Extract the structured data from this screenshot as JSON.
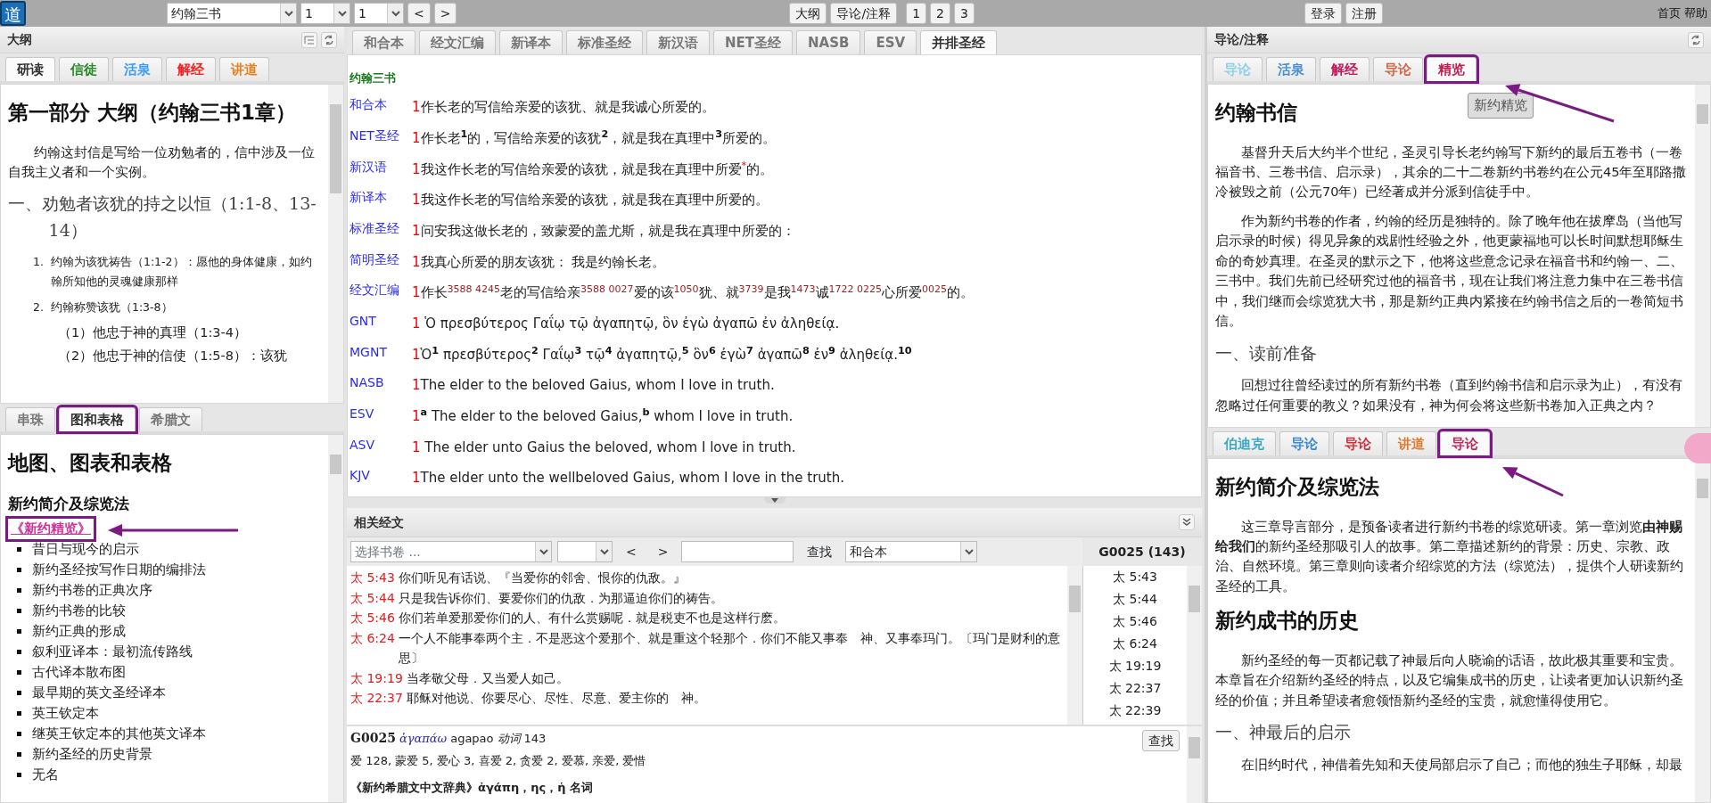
{
  "top_bar": {
    "logo": "道",
    "book_select": "约翰三书",
    "chapter_select": "1",
    "verse_select": "1",
    "prev": "<",
    "next": ">",
    "center_buttons": [
      "大纲",
      "导论/注释"
    ],
    "page_buttons": [
      "1",
      "2",
      "3"
    ],
    "account_buttons": [
      "登录",
      "注册"
    ],
    "links": [
      "首页",
      "帮助"
    ]
  },
  "outline_panel": {
    "title": "大纲",
    "tabs": [
      {
        "label": "研读",
        "color": "#333333",
        "selected": true
      },
      {
        "label": "信徒",
        "color": "#2a8a2a",
        "selected": false
      },
      {
        "label": "活泉",
        "color": "#3b9cff",
        "selected": false
      },
      {
        "label": "解经",
        "color": "#ff1a1a",
        "selected": false
      },
      {
        "label": "讲道",
        "color": "#e8801f",
        "selected": false
      }
    ],
    "content": [
      {
        "kind": "h1",
        "text": "第一部分 大纲（约翰三书1章）"
      },
      {
        "kind": "para",
        "text": "约翰这封信是写给一位劝勉者的，信中涉及一位自我主义者和一个实例。"
      },
      {
        "kind": "serif",
        "text": "一、劝勉者该犹的持之以恒（1:1-8、13-14）"
      },
      {
        "kind": "numbered",
        "number": "1.",
        "text": "约翰为该犹祷告（1:1-2）：愿他的身体健康，如约翰所知他的灵魂健康那样"
      },
      {
        "kind": "numbered",
        "number": "2.",
        "text": "约翰称赞该犹（1:3-8）"
      },
      {
        "kind": "sub",
        "text": "（1）他忠于神的真理（1:3-4）"
      },
      {
        "kind": "sub",
        "text": "（2）他忠于神的信使（1:5-8）：该犹"
      }
    ]
  },
  "charts_panel": {
    "tabs": [
      {
        "label": "串珠",
        "selected": false,
        "highlighted": false
      },
      {
        "label": "图和表格",
        "selected": true,
        "highlighted": true
      },
      {
        "label": "希腊文",
        "selected": false,
        "highlighted": false
      }
    ],
    "content": [
      {
        "kind": "h1",
        "text": "地图、图表和表格"
      },
      {
        "kind": "h3",
        "text": "新约简介及综览法"
      },
      {
        "kind": "link",
        "text": "《新约精览》",
        "highlighted": true,
        "arrow": true
      },
      {
        "kind": "bullet",
        "text": "昔日与现今的启示"
      },
      {
        "kind": "bullet",
        "text": "新约圣经按写作日期的编排法"
      },
      {
        "kind": "bullet",
        "text": "新约书卷的正典次序"
      },
      {
        "kind": "bullet",
        "text": "新约书卷的比较"
      },
      {
        "kind": "bullet",
        "text": "新约正典的形成"
      },
      {
        "kind": "bullet",
        "text": "叙利亚译本：最初流传路线"
      },
      {
        "kind": "bullet",
        "text": "古代译本散布图"
      },
      {
        "kind": "bullet",
        "text": "最早期的英文圣经译本"
      },
      {
        "kind": "bullet",
        "text": "英王钦定本"
      },
      {
        "kind": "bullet",
        "text": "继英王钦定本的其他英文译本"
      },
      {
        "kind": "bullet",
        "text": "新约圣经的历史背景"
      },
      {
        "kind": "bullet",
        "text": "无名"
      }
    ]
  },
  "bible_panel": {
    "tabs": [
      {
        "label": "和合本",
        "selected": false
      },
      {
        "label": "经文汇编",
        "selected": false
      },
      {
        "label": "新译本",
        "selected": false
      },
      {
        "label": "标准圣经",
        "selected": false
      },
      {
        "label": "新汉语",
        "selected": false
      },
      {
        "label": "NET圣经",
        "selected": false
      },
      {
        "label": "NASB",
        "selected": false
      },
      {
        "label": "ESV",
        "selected": false
      },
      {
        "label": "并排圣经",
        "selected": true
      }
    ],
    "book": "约翰三书",
    "verses": [
      {
        "version": "和合本",
        "number": "1",
        "kind": "plain",
        "text": "作长老的写信给亲爱的该犹、就是我诚心所爱的。"
      },
      {
        "version": "NET圣经",
        "number": "1",
        "kind": "notes",
        "text": "作长老$^{1}$的，写信给亲爱的该犹$^{2}$，就是我在真理中$^{3}$所爱的。"
      },
      {
        "version": "新汉语",
        "number": "1",
        "kind": "marked",
        "text": "我这作长老的写信给亲爱的该犹，就是我在真理中所爱$^{*}$的。"
      },
      {
        "version": "新译本",
        "number": "1",
        "kind": "plain",
        "text": "我这作长老的写信给亲爱的该犹，就是我在真理中所爱的。"
      },
      {
        "version": "标准圣经",
        "number": "1",
        "kind": "plain",
        "text": "问安我这做长老的，致蒙爱的盖尤斯，就是我在真理中所爱的："
      },
      {
        "version": "简明圣经",
        "number": "1",
        "kind": "plain",
        "text": "我真心所爱的朋友该犹：  我是约翰长老。"
      },
      {
        "version": "经文汇编",
        "number": "1",
        "kind": "strongs",
        "text": "作长$^{3588 4245}$老的写信给亲$^{3588 0027}$爱的该$^{1050}$犹、就$^{3739}$是我$^{1473}$诚$^{1722 0225}$心所爱$^{0025}$的。"
      },
      {
        "version": "GNT",
        "number": "1",
        "kind": "plain",
        "text": "  Ὁ πρεσβύτερος Γαΐῳ τῷ ἀγαπητῷ, ὃν ἐγὼ ἀγαπῶ ἐν ἀληθείᾳ."
      },
      {
        "version": "MGNT",
        "number": "1",
        "kind": "notes",
        "text": "Ὁ$^{1}$ πρεσβύτερος$^{2}$ Γαΐῳ$^{3}$ τῷ$^{4}$ ἀγαπητῷ,$^{5}$ ὃν$^{6}$ ἐγὼ$^{7}$ ἀγαπῶ$^{8}$ ἐν$^{9}$ ἀληθείᾳ.$^{10}$"
      },
      {
        "version": "NASB",
        "number": "1",
        "kind": "plain",
        "text": "The elder to the beloved Gaius, whom I love in truth."
      },
      {
        "version": "ESV",
        "number": "1",
        "kind": "notes",
        "text": "$^{a}$ The elder to the beloved Gaius,$^{b}$ whom I love in truth."
      },
      {
        "version": "ASV",
        "number": "1",
        "kind": "plain",
        "text": "  The elder unto Gaius the beloved, whom I love in truth."
      },
      {
        "version": "KJV",
        "number": "1",
        "kind": "plain",
        "text": "The elder unto the wellbeloved Gaius, whom I love in the truth."
      }
    ]
  },
  "related_panel": {
    "title": "相关经文",
    "book_placeholder": "选择书卷 ...",
    "prev": "<",
    "next": ">",
    "search_label": "查找",
    "version_select": "和合本",
    "verses": [
      {
        "ref": "太 5:43",
        "text": "你们听见有话说、『当爱你的邻舍、恨你的仇敌。』"
      },
      {
        "ref": "太 5:44",
        "text": "只是我告诉你们、要爱你们的仇敌．为那逼迫你们的祷告。"
      },
      {
        "ref": "太 5:46",
        "text": "你们若单爱那爱你们的人、有什么赏赐呢．就是税吏不也是这样行麽。"
      },
      {
        "ref": "太 6:24",
        "text": "一个人不能事奉两个主．不是恶这个爱那个、就是重这个轻那个．你们不能又事奉　神、又事奉玛门。〔玛门是财利的意思〕"
      },
      {
        "ref": "太 19:19",
        "text": "当孝敬父母．又当爱人如己。"
      },
      {
        "ref": "太 22:37",
        "text": "耶稣对他说、你要尽心、尽性、尽意、爱主你的　神。"
      }
    ],
    "list_title": "G0025 (143)",
    "list_items": [
      "太 5:43",
      "太 5:44",
      "太 5:46",
      "太 6:24",
      "太 19:19",
      "太 22:37",
      "太 22:39"
    ],
    "lexicon": {
      "code": "G0025",
      "greek": "ἀγαπάω",
      "translit": "agapao",
      "pos": "动词",
      "count": "143",
      "meanings": "爱 128, 蒙爱 5, 爱心 3, 喜爱 2, 贪爱 2, 爱慕, 亲爱, 爱惜",
      "dictionary": "《新约希腊文中文辞典》ἀγάπη，ης，ἡ 名词",
      "button": "查找"
    }
  },
  "commentary_panel": {
    "title": "导论/注释",
    "tooltip": "新约精览",
    "tabs": [
      {
        "label": "导论",
        "color": "#8fd0e8",
        "selected": false,
        "highlighted": false
      },
      {
        "label": "活泉",
        "color": "#4a8fd0",
        "selected": false,
        "highlighted": false
      },
      {
        "label": "解经",
        "color": "#c0185a",
        "selected": false,
        "highlighted": false
      },
      {
        "label": "导论",
        "color": "#d06848",
        "selected": false,
        "highlighted": false
      },
      {
        "label": "精览",
        "color": "#c02050",
        "selected": true,
        "highlighted": true,
        "arrow": true
      }
    ],
    "content": [
      {
        "kind": "h1",
        "text": "约翰书信"
      },
      {
        "kind": "para",
        "text": "基督升天后大约半个世纪，圣灵引导长老约翰写下新约的最后五卷书（一卷福音书、三卷书信、启示录），其余的二十二卷新约书卷约在公元45年至耶路撒冷被毁之前（公元70年）已经著成并分派到信徒手中。"
      },
      {
        "kind": "para",
        "text": "作为新约书卷的作者，约翰的经历是独特的。除了晚年他在拔摩岛（当他写启示录的时候）得见异象的戏剧性经验之外，他更蒙福地可以长时间默想耶稣生命的奇妙真理。在圣灵的默示之下，他将这些意念记录在福音书和约翰一、二、三书中。我们先前已经研究过他的福音书，现在让我们将注意力集中在三卷书信中，我们继而会综览犹大书，那是新约正典内紧接在约翰书信之后的一卷简短书信。"
      },
      {
        "kind": "serif",
        "text": "一、读前准备"
      },
      {
        "kind": "para",
        "text": "回想过往曾经读过的所有新约书卷（直到约翰书信和启示录为止），有没有忽略过任何重要的教义？如果没有，神为何会将这些新书卷加入正典之内？"
      }
    ]
  },
  "introduction_panel": {
    "tabs": [
      {
        "label": "伯迪克",
        "color": "#3aa8c8",
        "selected": false,
        "highlighted": false
      },
      {
        "label": "导论",
        "color": "#3a8ad8",
        "selected": false,
        "highlighted": false
      },
      {
        "label": "导论",
        "color": "#d0303a",
        "selected": false,
        "highlighted": false
      },
      {
        "label": "讲道",
        "color": "#e07a30",
        "selected": false,
        "highlighted": false
      },
      {
        "label": "导论",
        "color": "#c02a5a",
        "selected": true,
        "highlighted": true,
        "arrow": true
      }
    ],
    "content": [
      {
        "kind": "h1",
        "text": "新约简介及综览法"
      },
      {
        "kind": "para",
        "text": "这三章导言部分，是预备读者进行新约书卷的综览研读。第一章浏览**由神赐给我们**的新约圣经那吸引人的故事。第二章描述新约的背景：历史、宗教、政治、自然环境。第三章则向读者介绍综览的方法（综览法），提供个人研读新约圣经的工具。"
      },
      {
        "kind": "h1",
        "text": "新约成书的历史"
      },
      {
        "kind": "para",
        "text": "新约圣经的每一页都记载了神最后向人晓谕的话语，故此极其重要和宝贵。本章旨在介绍新约圣经的特点，以及它编集成书的历史，让读者更加认识新约圣经的价值；并且希望读者愈领悟新约圣经的宝贵，就愈懂得使用它。"
      },
      {
        "kind": "serif",
        "text": "一、神最后的启示"
      },
      {
        "kind": "para",
        "text": "在旧约时代，神借着先知和天使局部启示了自己；而他的独生子耶稣，却最"
      }
    ]
  }
}
